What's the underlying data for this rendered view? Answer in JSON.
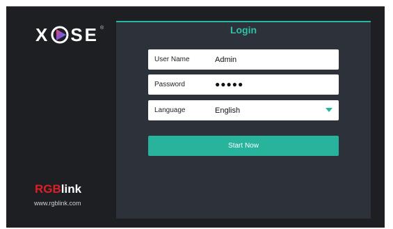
{
  "brand": {
    "logo_text_left": "X",
    "logo_text_right": "SE",
    "logo_mark": "®",
    "company_r": "R",
    "company_g": "G",
    "company_b": "B",
    "company_link": "link",
    "website": "www.rgblink.com"
  },
  "login": {
    "title": "Login",
    "username_label": "User Name",
    "username_value": "Admin",
    "password_label": "Password",
    "password_value": "●●●●●",
    "language_label": "Language",
    "language_value": "English",
    "submit_label": "Start Now"
  },
  "colors": {
    "accent": "#27b39c",
    "background": "#1d1f23",
    "panel": "#2d313a",
    "brand_red": "#e01e25"
  },
  "icons": {
    "logo_play": "play-icon",
    "dropdown": "chevron-down-icon"
  }
}
